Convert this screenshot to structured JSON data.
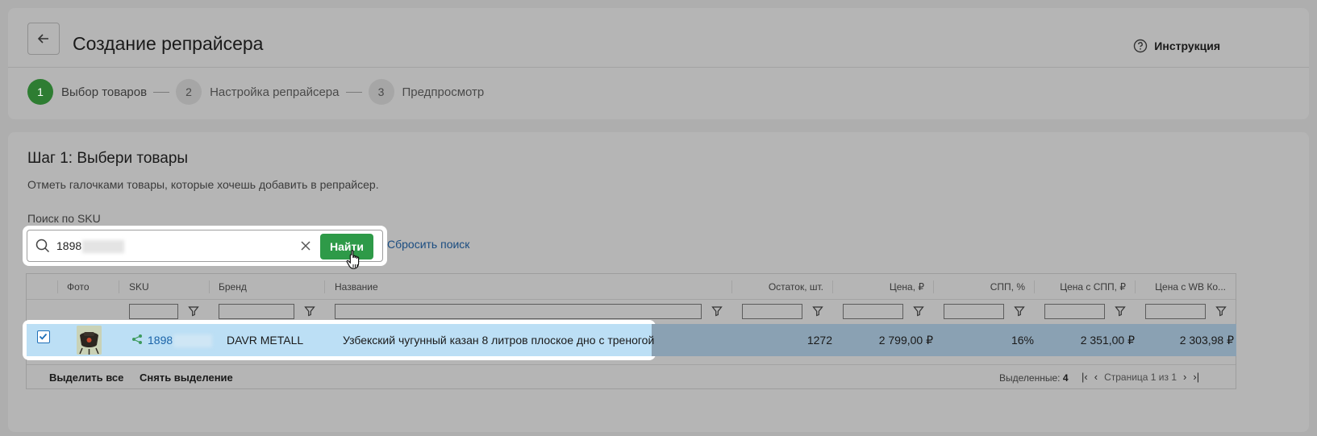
{
  "header": {
    "title": "Создание репрайсера",
    "help_label": "Инструкция"
  },
  "steps": [
    {
      "num": "1",
      "label": "Выбор товаров",
      "active": true
    },
    {
      "num": "2",
      "label": "Настройка репрайсера",
      "active": false
    },
    {
      "num": "3",
      "label": "Предпросмотр",
      "active": false
    }
  ],
  "main": {
    "title": "Шаг 1: Выбери товары",
    "description": "Отметь галочками товары, которые хочешь добавить в репрайсер.",
    "search_label": "Поиск по SKU",
    "search_value": "1898",
    "find_button": "Найти",
    "reset_link": "Сбросить поиск"
  },
  "table": {
    "columns": [
      "Фото",
      "SKU",
      "Бренд",
      "Название",
      "Остаток, шт.",
      "Цена, ₽",
      "СПП, %",
      "Цена с СПП, ₽",
      "Цена с WB Ко..."
    ],
    "rows": [
      {
        "selected": true,
        "sku": "1898",
        "brand": "DAVR METALL",
        "name": "Узбекский чугунный казан 8 литров плоское дно с треногой",
        "stock": "1272",
        "price": "2 799,00 ₽",
        "spp": "16%",
        "price_spp": "2 351,00 ₽",
        "price_wb": "2 303,98 ₽"
      }
    ],
    "footer": {
      "select_all": "Выделить все",
      "deselect": "Снять выделение",
      "selected_label": "Выделенные:",
      "selected_count": "4",
      "page_text": "Страница 1 из 1"
    }
  },
  "colors": {
    "accent_green": "#2e9a48",
    "step_active": "#2e7d32",
    "link": "#1a4c80",
    "row_selected": "#bcdff5"
  }
}
